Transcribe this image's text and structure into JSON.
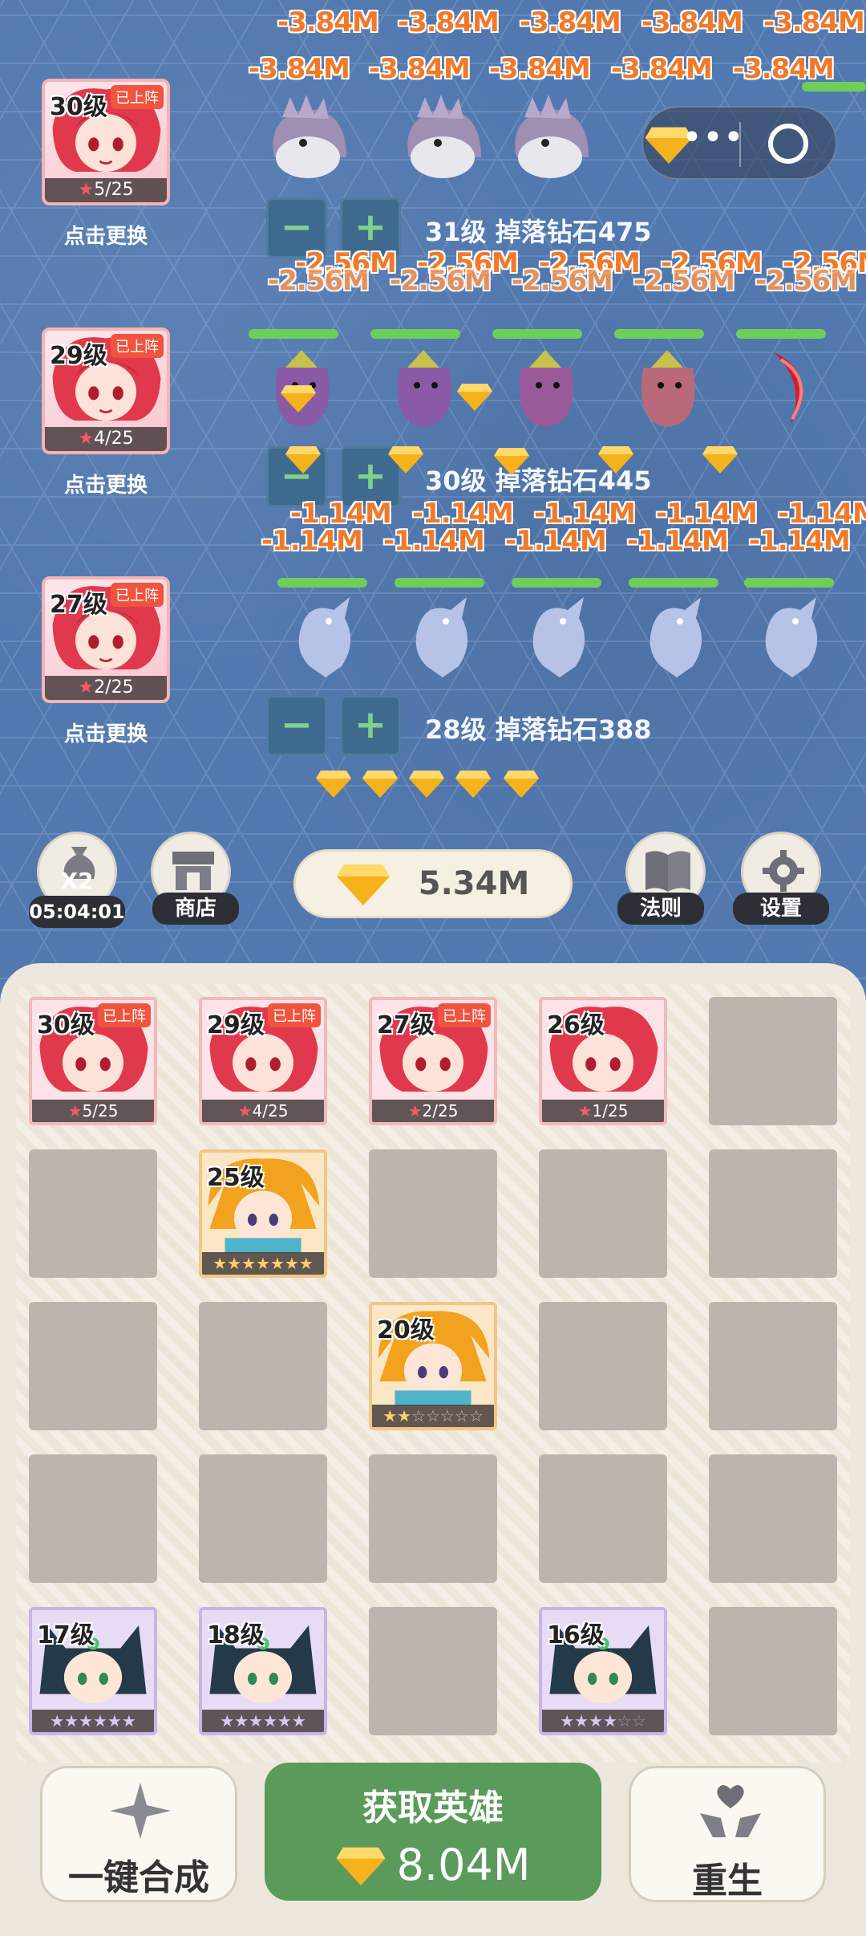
{
  "battle": {
    "lanes": [
      {
        "hero": {
          "level": "30级",
          "status": "已上阵",
          "stars": "5/25"
        },
        "swap_label": "点击更换",
        "damage_row1": [
          "-3.84M",
          "-3.84M",
          "-3.84M",
          "-3.84M",
          "-3.84M"
        ],
        "damage_row2": [
          "-3.84M",
          "-3.84M",
          "-3.84M",
          "-3.84M",
          "-3.84M"
        ],
        "monster_level": "31级",
        "drop_text": "掉落钻石475"
      },
      {
        "hero": {
          "level": "29级",
          "status": "已上阵",
          "stars": "4/25"
        },
        "swap_label": "点击更换",
        "damage_row1": [
          "-2.56M",
          "-2.56M",
          "-2.56M",
          "-2.56M",
          "-2.56M"
        ],
        "damage_row2": [
          "-2.56M",
          "-2.56M",
          "-2.56M",
          "-2.56M",
          "-2.56M"
        ],
        "monster_level": "30级",
        "drop_text": "掉落钻石445"
      },
      {
        "hero": {
          "level": "27级",
          "status": "已上阵",
          "stars": "2/25"
        },
        "swap_label": "点击更换",
        "damage_row1": [
          "-1.14M",
          "-1.14M",
          "-1.14M",
          "-1.14M",
          "-1.14M"
        ],
        "damage_row2": [
          "-1.14M",
          "-1.14M",
          "-1.14M",
          "-1.14M",
          "-1.14M"
        ],
        "monster_level": "28级",
        "drop_text": "掉落钻石388"
      }
    ],
    "minus_symbol": "−",
    "plus_symbol": "+"
  },
  "toolbar": {
    "x2_label": "X2",
    "timer": "05:04:01",
    "shop_label": "商店",
    "gems": "5.34M",
    "rules_label": "法则",
    "settings_label": "设置"
  },
  "bench": {
    "cards": [
      {
        "level": "30级",
        "status": "已上阵",
        "stars": "5/25"
      },
      {
        "level": "29级",
        "status": "已上阵",
        "stars": "4/25"
      },
      {
        "level": "27级",
        "status": "已上阵",
        "stars": "2/25"
      },
      {
        "level": "26级",
        "stars": "1/25"
      },
      {
        "level": "25级",
        "stars_rating": 7,
        "stars_max": 7
      },
      {
        "level": "20级",
        "stars_rating": 2,
        "stars_max": 7
      },
      {
        "level": "17级",
        "stars_rating": 6,
        "stars_max": 6
      },
      {
        "level": "18级",
        "stars_rating": 6,
        "stars_max": 6
      },
      {
        "level": "16级",
        "stars_rating": 4,
        "stars_max": 6
      }
    ]
  },
  "actions": {
    "merge_label": "一键合成",
    "get_hero_label": "获取英雄",
    "get_hero_cost": "8.04M",
    "rebirth_label": "重生"
  },
  "colors": {
    "damage": "#f07a2a",
    "deploy_badge": "#f0543f",
    "get_button": "#5a9b5c",
    "battle_bg": "#5279af"
  }
}
